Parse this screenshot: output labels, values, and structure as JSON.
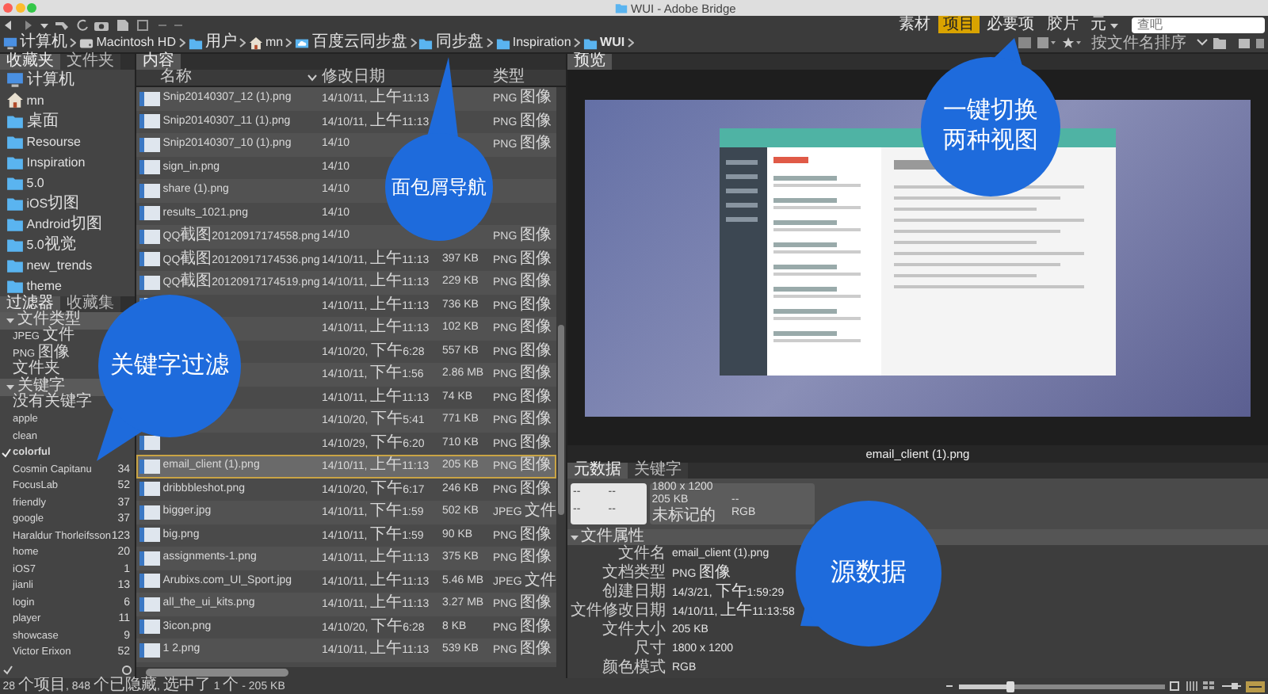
{
  "window": {
    "title": "WUI - Adobe Bridge"
  },
  "breadcrumb": [
    {
      "label": "计算机",
      "kind": "computer"
    },
    {
      "label": "Macintosh HD",
      "kind": "drive"
    },
    {
      "label": "用户",
      "kind": "folder"
    },
    {
      "label": "mn",
      "kind": "home"
    },
    {
      "label": "百度云同步盘",
      "kind": "cloud"
    },
    {
      "label": "同步盘",
      "kind": "folder"
    },
    {
      "label": "Inspiration",
      "kind": "folder"
    },
    {
      "label": "WUI",
      "kind": "folder",
      "current": true
    }
  ],
  "workspaces": [
    {
      "label": "素材",
      "selected": false,
      "has_menu": false
    },
    {
      "label": "项目",
      "selected": true,
      "has_menu": false
    },
    {
      "label": "必要项",
      "selected": false,
      "has_menu": false
    },
    {
      "label": "胶片",
      "selected": false,
      "has_menu": false
    },
    {
      "label": "元",
      "selected": false,
      "has_menu": true
    }
  ],
  "search": {
    "placeholder": "查吧"
  },
  "sort": {
    "label": "按文件名排序"
  },
  "favorites": {
    "tabs": [
      {
        "label": "收藏夹",
        "selected": true
      },
      {
        "label": "文件夹",
        "selected": false
      }
    ],
    "items": [
      {
        "label": "计算机",
        "kind": "computer"
      },
      {
        "label": "mn",
        "kind": "home"
      },
      {
        "label": "桌面",
        "kind": "folder"
      },
      {
        "label": "Resourse",
        "kind": "folder"
      },
      {
        "label": "Inspiration",
        "kind": "folder"
      },
      {
        "label": "5.0",
        "kind": "folder"
      },
      {
        "label": "iOS切图",
        "kind": "folder"
      },
      {
        "label": "Android切图",
        "kind": "folder"
      },
      {
        "label": "5.0视觉",
        "kind": "folder"
      },
      {
        "label": "new_trends",
        "kind": "folder"
      },
      {
        "label": "theme",
        "kind": "folder"
      }
    ]
  },
  "filter": {
    "tabs": [
      {
        "label": "过滤器",
        "selected": true
      },
      {
        "label": "收藏集",
        "selected": false
      }
    ],
    "groups": [
      {
        "label": "文件类型",
        "expanded": true,
        "items": [
          {
            "label": "JPEG 文件",
            "checked": false
          },
          {
            "label": "PNG 图像",
            "checked": false
          },
          {
            "label": "文件夹",
            "checked": false
          }
        ]
      },
      {
        "label": "关键字",
        "expanded": true,
        "items": [
          {
            "label": "没有关键字",
            "checked": false
          },
          {
            "label": "apple",
            "checked": false
          },
          {
            "label": "clean",
            "checked": false
          },
          {
            "label": "colorful",
            "checked": true
          },
          {
            "label": "Cosmin Capitanu",
            "count": "34",
            "checked": false
          },
          {
            "label": "FocusLab",
            "count": "52",
            "checked": false
          },
          {
            "label": "friendly",
            "count": "37",
            "checked": false
          },
          {
            "label": "google",
            "count": "37",
            "checked": false
          },
          {
            "label": "Haraldur Thorleifsson",
            "count": "123",
            "checked": false
          },
          {
            "label": "home",
            "count": "20",
            "checked": false
          },
          {
            "label": "iOS7",
            "count": "1",
            "checked": false
          },
          {
            "label": "jianli",
            "count": "13",
            "checked": false
          },
          {
            "label": "login",
            "count": "6",
            "checked": false
          },
          {
            "label": "player",
            "count": "11",
            "checked": false
          },
          {
            "label": "showcase",
            "count": "9",
            "checked": false
          },
          {
            "label": "Victor Erixon",
            "count": "52",
            "checked": false
          }
        ]
      }
    ]
  },
  "content": {
    "title": "内容",
    "columns": {
      "name": "名称",
      "date": "修改日期",
      "type": "类型"
    },
    "rows": [
      {
        "name": "Snip20140307_12 (1).png",
        "date": "14/10/11, 上午11:13",
        "type": "PNG 图像",
        "selected": false
      },
      {
        "name": "Snip20140307_11 (1).png",
        "date": "14/10/11, 上午11:13",
        "type": "PNG 图像",
        "selected": false
      },
      {
        "name": "Snip20140307_10 (1).png",
        "date": "14/10",
        "type": "PNG 图像",
        "selected": false
      },
      {
        "name": "sign_in.png",
        "date": "14/10",
        "selected": false
      },
      {
        "name": "share (1).png",
        "date": "14/10",
        "selected": false
      },
      {
        "name": "results_1021.png",
        "date": "14/10",
        "selected": false
      },
      {
        "name": "QQ截图20120917174558.png",
        "date": "14/10",
        "type": "PNG 图像",
        "selected": false
      },
      {
        "name": "QQ截图20120917174536.png",
        "date": "14/10/11, 上午11:13",
        "size": "397 KB",
        "type": "PNG 图像",
        "selected": false
      },
      {
        "name": "QQ截图20120917174519.png",
        "date": "14/10/11, 上午11:13",
        "size": "229 KB",
        "type": "PNG 图像",
        "selected": false
      },
      {
        "date": "14/10/11, 上午11:13",
        "size": "736 KB",
        "type": "PNG 图像",
        "selected": false
      },
      {
        "date": "14/10/11, 上午11:13",
        "size": "102 KB",
        "type": "PNG 图像",
        "selected": false
      },
      {
        "date": "14/10/20, 下午6:28",
        "size": "557 KB",
        "type": "PNG 图像",
        "selected": false
      },
      {
        "date": "14/10/11, 下午1:56",
        "size": "2.86 MB",
        "type": "PNG 图像",
        "selected": false
      },
      {
        "date": "14/10/11, 上午11:13",
        "size": "74 KB",
        "type": "PNG 图像",
        "selected": false
      },
      {
        "date": "14/10/20, 下午5:41",
        "size": "771 KB",
        "type": "PNG 图像",
        "selected": false
      },
      {
        "date": "14/10/29, 下午6:20",
        "size": "710 KB",
        "type": "PNG 图像",
        "selected": false
      },
      {
        "name": "email_client (1).png",
        "date": "14/10/11, 上午11:13",
        "size": "205 KB",
        "type": "PNG 图像",
        "selected": true
      },
      {
        "name": "dribbbleshot.png",
        "date": "14/10/20, 下午6:17",
        "size": "246 KB",
        "type": "PNG 图像",
        "selected": false
      },
      {
        "name": "bigger.jpg",
        "date": "14/10/11, 下午1:59",
        "size": "502 KB",
        "type": "JPEG 文件",
        "selected": false
      },
      {
        "name": "big.png",
        "date": "14/10/11, 下午1:59",
        "size": "90 KB",
        "type": "PNG 图像",
        "selected": false
      },
      {
        "name": "assignments-1.png",
        "date": "14/10/11, 上午11:13",
        "size": "375 KB",
        "type": "PNG 图像",
        "selected": false
      },
      {
        "name": "Arubixs.com_UI_Sport.jpg",
        "date": "14/10/11, 上午11:13",
        "size": "5.46 MB",
        "type": "JPEG 文件",
        "selected": false
      },
      {
        "name": "all_the_ui_kits.png",
        "date": "14/10/11, 上午11:13",
        "size": "3.27 MB",
        "type": "PNG 图像",
        "selected": false
      },
      {
        "name": "3icon.png",
        "date": "14/10/20, 下午6:28",
        "size": "8 KB",
        "type": "PNG 图像",
        "selected": false
      },
      {
        "name": "1 2.png",
        "date": "14/10/11, 上午11:13",
        "size": "539 KB",
        "type": "PNG 图像",
        "selected": false
      }
    ]
  },
  "preview": {
    "title": "预览",
    "caption": "email_client (1).png"
  },
  "metadata": {
    "tabs": [
      {
        "label": "元数据",
        "selected": true
      },
      {
        "label": "关键字",
        "selected": false
      }
    ],
    "camera": [
      "--",
      "--",
      "--",
      "--"
    ],
    "summary": [
      "1800 x 1200",
      "205 KB",
      "--",
      "未标记的",
      "RGB"
    ],
    "section": {
      "label": "文件属性",
      "expanded": true,
      "fields": [
        {
          "label": "文件名",
          "value": "email_client (1).png"
        },
        {
          "label": "文档类型",
          "value": "PNG 图像"
        },
        {
          "label": "创建日期",
          "value": "14/3/21, 下午1:59:29"
        },
        {
          "label": "文件修改日期",
          "value": "14/10/11, 上午11:13:58"
        },
        {
          "label": "文件大小",
          "value": "205 KB"
        },
        {
          "label": "尺寸",
          "value": "1800 x 1200"
        },
        {
          "label": "颜色模式",
          "value": "RGB"
        }
      ]
    }
  },
  "status_bar": "28 个项目, 848 个已隐藏, 选中了 1 个 - 205 KB",
  "thumb_size": {
    "level": 0.25
  },
  "callouts": [
    {
      "lines": [
        "面包屑导航"
      ]
    },
    {
      "lines": [
        "一键切换",
        "两种视图"
      ]
    },
    {
      "lines": [
        "关键字过滤"
      ]
    },
    {
      "lines": [
        "源数据"
      ]
    }
  ]
}
